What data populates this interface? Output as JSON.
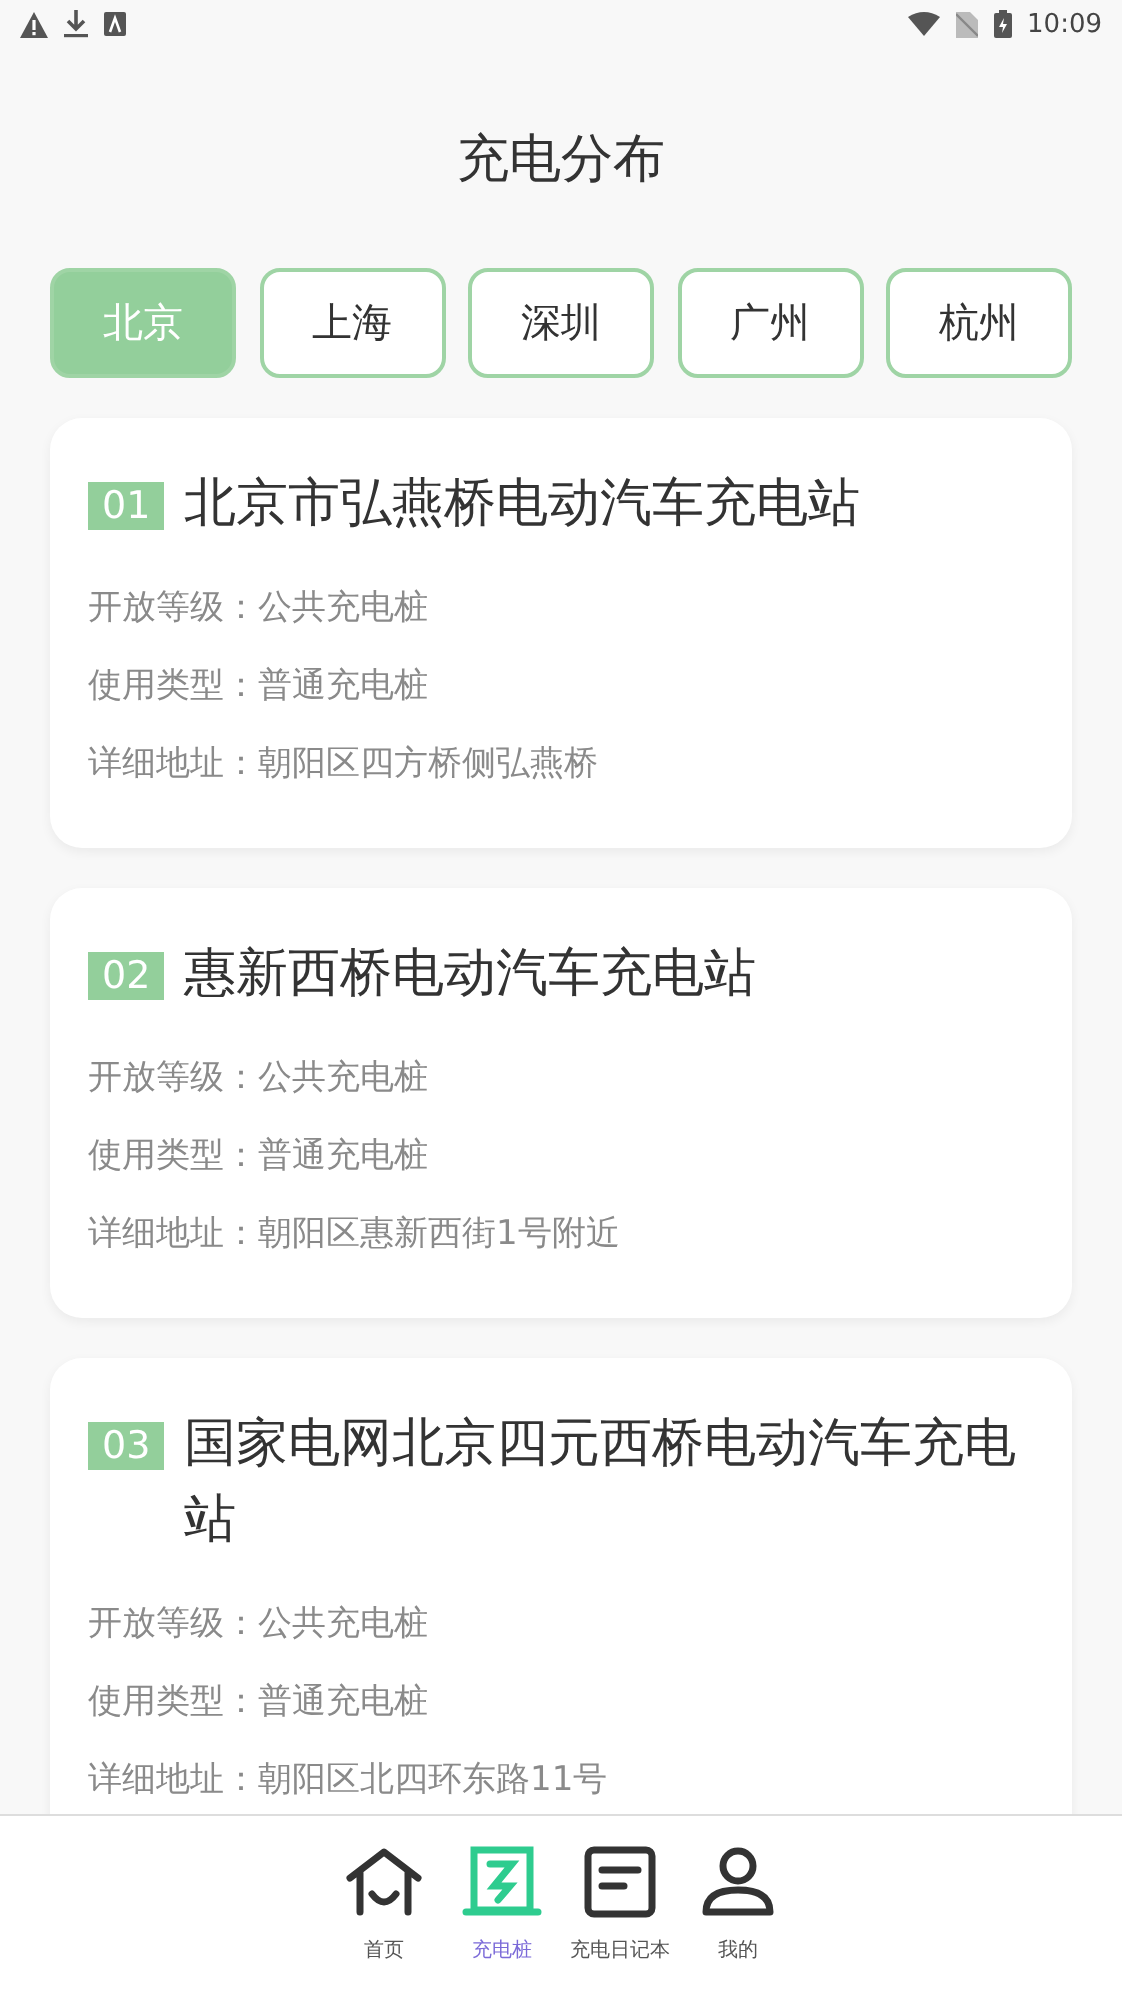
{
  "status_bar": {
    "time": "10:09"
  },
  "title": "充电分布",
  "city_tabs": [
    {
      "label": "北京",
      "selected": true
    },
    {
      "label": "上海",
      "selected": false
    },
    {
      "label": "深圳",
      "selected": false
    },
    {
      "label": "广州",
      "selected": false
    },
    {
      "label": "杭州",
      "selected": false
    }
  ],
  "stations": [
    {
      "number": "01",
      "name": "北京市弘燕桥电动汽车充电站",
      "details": [
        "开放等级：公共充电桩",
        "使用类型：普通充电桩",
        "详细地址：朝阳区四方桥侧弘燕桥"
      ]
    },
    {
      "number": "02",
      "name": "惠新西桥电动汽车充电站",
      "details": [
        "开放等级：公共充电桩",
        "使用类型：普通充电桩",
        "详细地址：朝阳区惠新西街1号附近"
      ]
    },
    {
      "number": "03",
      "name": "国家电网北京四元西桥电动汽车充电站",
      "details": [
        "开放等级：公共充电桩",
        "使用类型：普通充电桩",
        "详细地址：朝阳区北四环东路11号"
      ]
    }
  ],
  "bottom_nav": [
    {
      "label": "首页",
      "kind": "home",
      "selected": false
    },
    {
      "label": "充电桩",
      "kind": "charger",
      "selected": true
    },
    {
      "label": "充电日记本",
      "kind": "notes",
      "selected": false
    },
    {
      "label": "我的",
      "kind": "profile",
      "selected": false
    }
  ]
}
